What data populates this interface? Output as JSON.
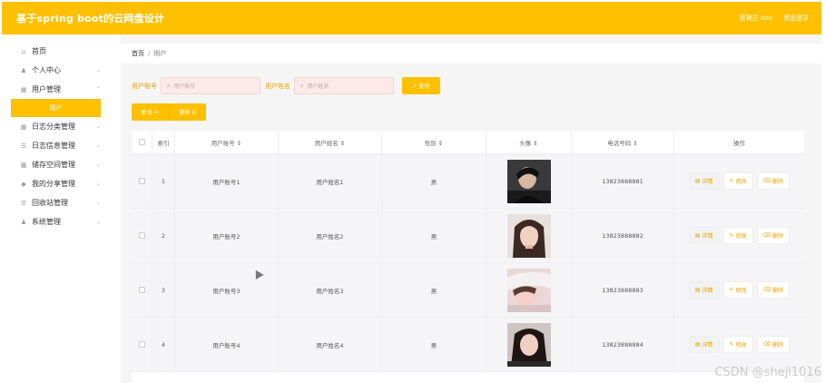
{
  "header": {
    "title": "基于spring boot的云网盘设计",
    "admin": "管理员 abo",
    "logout": "退出登录"
  },
  "sidebar": {
    "items": [
      {
        "icon": "home-icon",
        "glyph": "⌂",
        "label": "首页",
        "chevron": ""
      },
      {
        "icon": "user-icon",
        "glyph": "♟",
        "label": "个人中心",
        "chevron": "⌄"
      },
      {
        "icon": "grid-icon",
        "glyph": "▦",
        "label": "用户管理",
        "chevron": "⌃"
      },
      {
        "icon": "grid-icon",
        "glyph": "▦",
        "label": "日志分类管理",
        "chevron": "⌄"
      },
      {
        "icon": "list-icon",
        "glyph": "☰",
        "label": "日志信息管理",
        "chevron": "⌄"
      },
      {
        "icon": "grid-icon",
        "glyph": "▦",
        "label": "储存空间管理",
        "chevron": "⌄"
      },
      {
        "icon": "shield-icon",
        "glyph": "◆",
        "label": "我的分享管理",
        "chevron": "⌄"
      },
      {
        "icon": "list-icon",
        "glyph": "☰",
        "label": "回收站管理",
        "chevron": "⌄"
      },
      {
        "icon": "user-icon",
        "glyph": "♟",
        "label": "系统管理",
        "chevron": "⌄"
      }
    ],
    "active_sub": "用户"
  },
  "breadcrumb": {
    "home": "首页",
    "separator": "/",
    "current": "用户"
  },
  "search": {
    "account_label": "用户账号",
    "account_placeholder": "用户账号",
    "name_label": "用户姓名",
    "name_placeholder": "用户姓名",
    "query": "查询"
  },
  "actions": {
    "add": "新增 ＋",
    "delete": "删除 ⊟"
  },
  "table": {
    "headers": [
      "",
      "索引",
      "用户账号 ⇕",
      "用户姓名 ⇕",
      "性别 ⇕",
      "头像 ⇕",
      "电话号码 ⇕",
      "操作"
    ],
    "rows": [
      {
        "index": "1",
        "account": "用户账号1",
        "name": "用户姓名1",
        "gender": "男",
        "phone": "13823888881"
      },
      {
        "index": "2",
        "account": "用户账号2",
        "name": "用户姓名2",
        "gender": "男",
        "phone": "13823888882"
      },
      {
        "index": "3",
        "account": "用户账号3",
        "name": "用户姓名3",
        "gender": "男",
        "phone": "13823888883"
      },
      {
        "index": "4",
        "account": "用户账号4",
        "name": "用户姓名4",
        "gender": "男",
        "phone": "13823888884"
      }
    ],
    "row_actions": {
      "detail": "详情",
      "edit": "修改",
      "delete": "删除"
    }
  },
  "watermark": "CSDN @sheji1016",
  "colors": {
    "accent": "#ffc000",
    "search_bg": "#fde9e9"
  }
}
